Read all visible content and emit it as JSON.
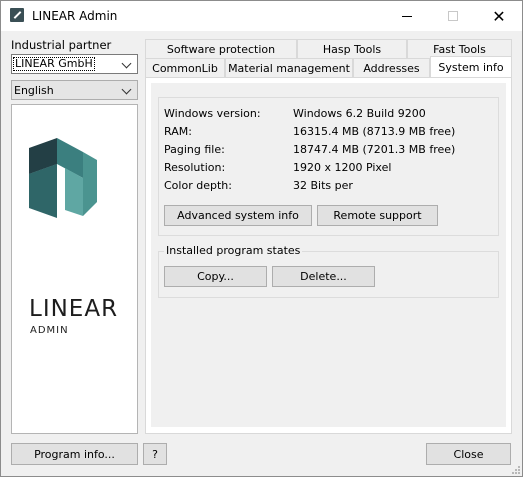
{
  "window": {
    "title": "LINEAR Admin",
    "icon": "linear-app-icon"
  },
  "left": {
    "partner_label": "Industrial partner",
    "partner_value": "LINEAR GmbH",
    "language_value": "English",
    "logo": {
      "word": "LINEAR",
      "sub": "ADMIN",
      "colors": {
        "dark": "#233f45",
        "mid": "#3b7f7f",
        "light": "#5fa7a3"
      }
    }
  },
  "tabs": {
    "row1": [
      "Software protection",
      "Hasp Tools",
      "Fast Tools"
    ],
    "row2": [
      "CommonLib",
      "Material management",
      "Addresses",
      "System info"
    ],
    "active": "System info"
  },
  "system_info": {
    "rows": [
      {
        "label": "Windows version:",
        "value": "Windows 6.2 Build 9200"
      },
      {
        "label": "RAM:",
        "value": "16315.4 MB (8713.9 MB free)"
      },
      {
        "label": "Paging file:",
        "value": "18747.4 MB (7201.3 MB free)"
      },
      {
        "label": "Resolution:",
        "value": "1920 x 1200 Pixel"
      },
      {
        "label": "Color depth:",
        "value": "32 Bits per"
      }
    ],
    "advanced_button": "Advanced system info",
    "remote_button": "Remote support"
  },
  "program_states": {
    "title": "Installed program states",
    "copy_button": "Copy...",
    "delete_button": "Delete..."
  },
  "footer": {
    "program_info_button": "Program info...",
    "help_button": "?",
    "close_button": "Close"
  }
}
